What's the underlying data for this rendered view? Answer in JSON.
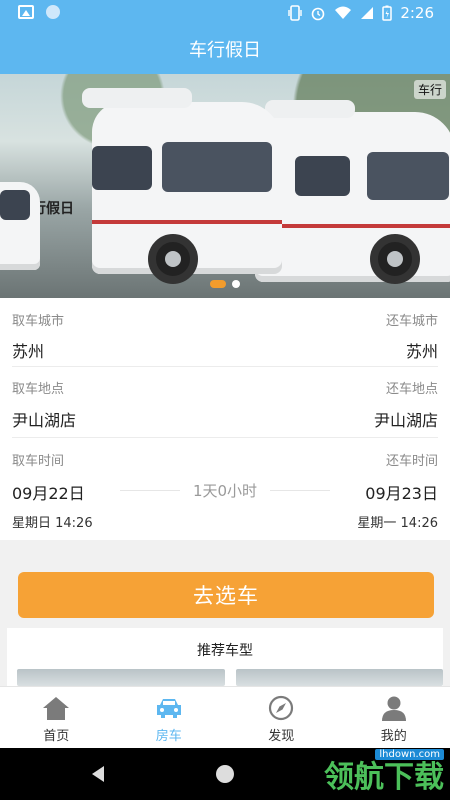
{
  "status_bar": {
    "time": "2:26",
    "icons": [
      "image-icon",
      "circle-icon",
      "vibrate-icon",
      "alarm-icon",
      "wifi-icon",
      "signal-icon",
      "battery-icon"
    ]
  },
  "header": {
    "title": "车行假日"
  },
  "banner": {
    "van_logo": "车行假日",
    "brand": "车行",
    "page_indicator": {
      "current": 1,
      "total": 2
    }
  },
  "form": {
    "pickup_city": {
      "label": "取车城市",
      "value": "苏州"
    },
    "return_city": {
      "label": "还车城市",
      "value": "苏州"
    },
    "pickup_location": {
      "label": "取车地点",
      "value": "尹山湖店"
    },
    "return_location": {
      "label": "还车地点",
      "value": "尹山湖店"
    },
    "pickup_time": {
      "label": "取车时间",
      "date": "09月22日",
      "weekday_time": "星期日 14:26"
    },
    "return_time": {
      "label": "还车时间",
      "date": "09月23日",
      "weekday_time": "星期一 14:26"
    },
    "duration": "1天0小时"
  },
  "action": {
    "choose_car_label": "去选车"
  },
  "recommend": {
    "title": "推荐车型"
  },
  "tabs": [
    {
      "label": "首页",
      "icon": "home-icon",
      "active": false
    },
    {
      "label": "房车",
      "icon": "car-icon",
      "active": true
    },
    {
      "label": "发现",
      "icon": "compass-icon",
      "active": false
    },
    {
      "label": "我的",
      "icon": "user-icon",
      "active": false
    }
  ],
  "colors": {
    "primary": "#5db7f0",
    "accent": "#f6a236"
  },
  "watermark": {
    "url": "lhdown.com",
    "text": "领航下载"
  }
}
